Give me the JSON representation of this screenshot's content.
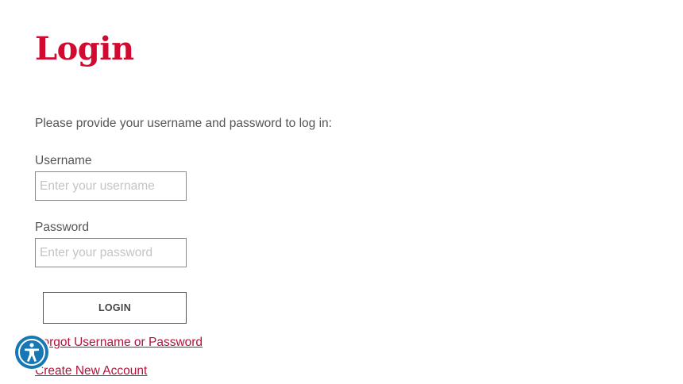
{
  "page": {
    "title": "Login",
    "intro": "Please provide your username and password to log in:"
  },
  "form": {
    "username_label": "Username",
    "username_placeholder": "Enter your username",
    "username_value": "",
    "password_label": "Password",
    "password_placeholder": "Enter your password",
    "password_value": "",
    "login_button_label": "LOGIN"
  },
  "links": {
    "forgot": "Forgot Username or Password",
    "create_account": "Create New Account"
  },
  "accessibility": {
    "icon": "accessibility-person-icon",
    "color": "#1777b4"
  },
  "colors": {
    "title": "#d10a2f",
    "link": "#b5113d"
  }
}
